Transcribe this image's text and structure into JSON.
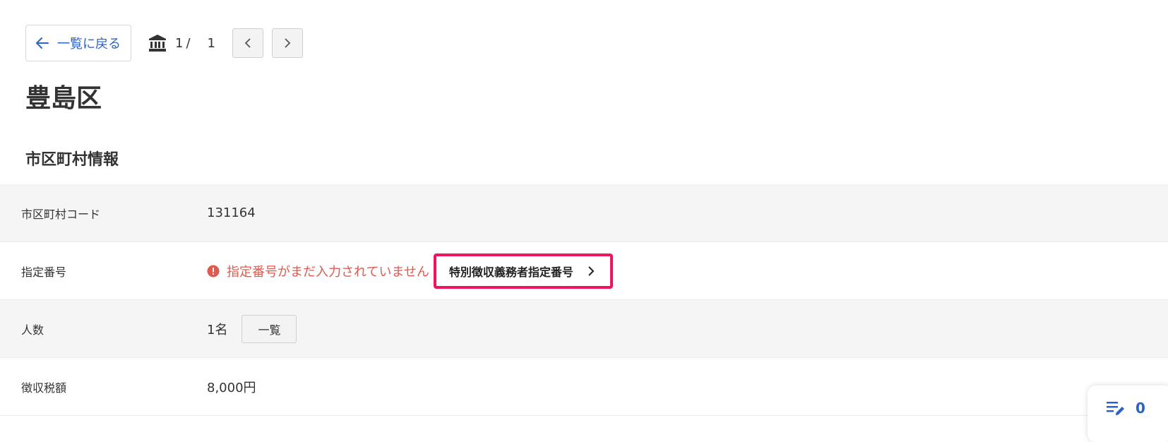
{
  "topbar": {
    "back_label": "一覧に戻る",
    "pager": {
      "current": "1",
      "separator": "/",
      "total": "1"
    }
  },
  "page_title": "豊島区",
  "section_title": "市区町村情報",
  "rows": {
    "code": {
      "label": "市区町村コード",
      "value": "131164"
    },
    "designation": {
      "label": "指定番号",
      "warning": "指定番号がまだ入力されていません",
      "button": "特別徴収義務者指定番号"
    },
    "count": {
      "label": "人数",
      "value": "1名",
      "button": "一覧"
    },
    "tax": {
      "label": "徴収税額",
      "value": "8,000円"
    }
  },
  "fab": {
    "count": "0",
    "icon": "edit-list-icon"
  },
  "colors": {
    "accent": "#2b63c8",
    "warning": "#e05a4f",
    "highlight": "#f0135f"
  }
}
